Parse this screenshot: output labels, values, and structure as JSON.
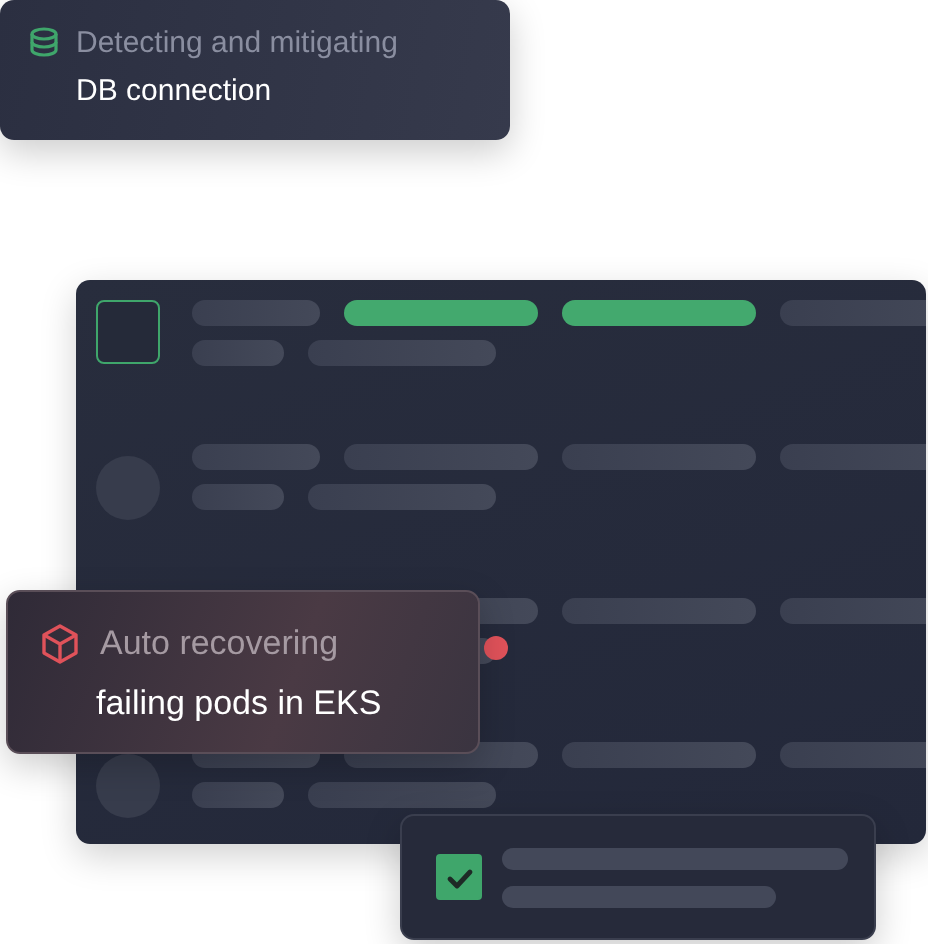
{
  "notifications": [
    {
      "kind": "database",
      "title": "Detecting and mitigating",
      "subtitle": "DB connection"
    },
    {
      "kind": "cube",
      "title": "Auto recovering",
      "subtitle": "failing pods in EKS"
    }
  ],
  "table": {
    "rows": [
      {
        "kind": "checkbox",
        "checked": false,
        "alert": false,
        "bars": [
          {
            "highlighted": false
          },
          {
            "highlighted": true
          },
          {
            "highlighted": true
          },
          {
            "highlighted": false
          }
        ]
      },
      {
        "kind": "avatar",
        "alert": false
      },
      {
        "kind": "covered",
        "alert": true
      },
      {
        "kind": "avatar",
        "alert": false
      }
    ]
  },
  "task": {
    "checked": true
  }
}
